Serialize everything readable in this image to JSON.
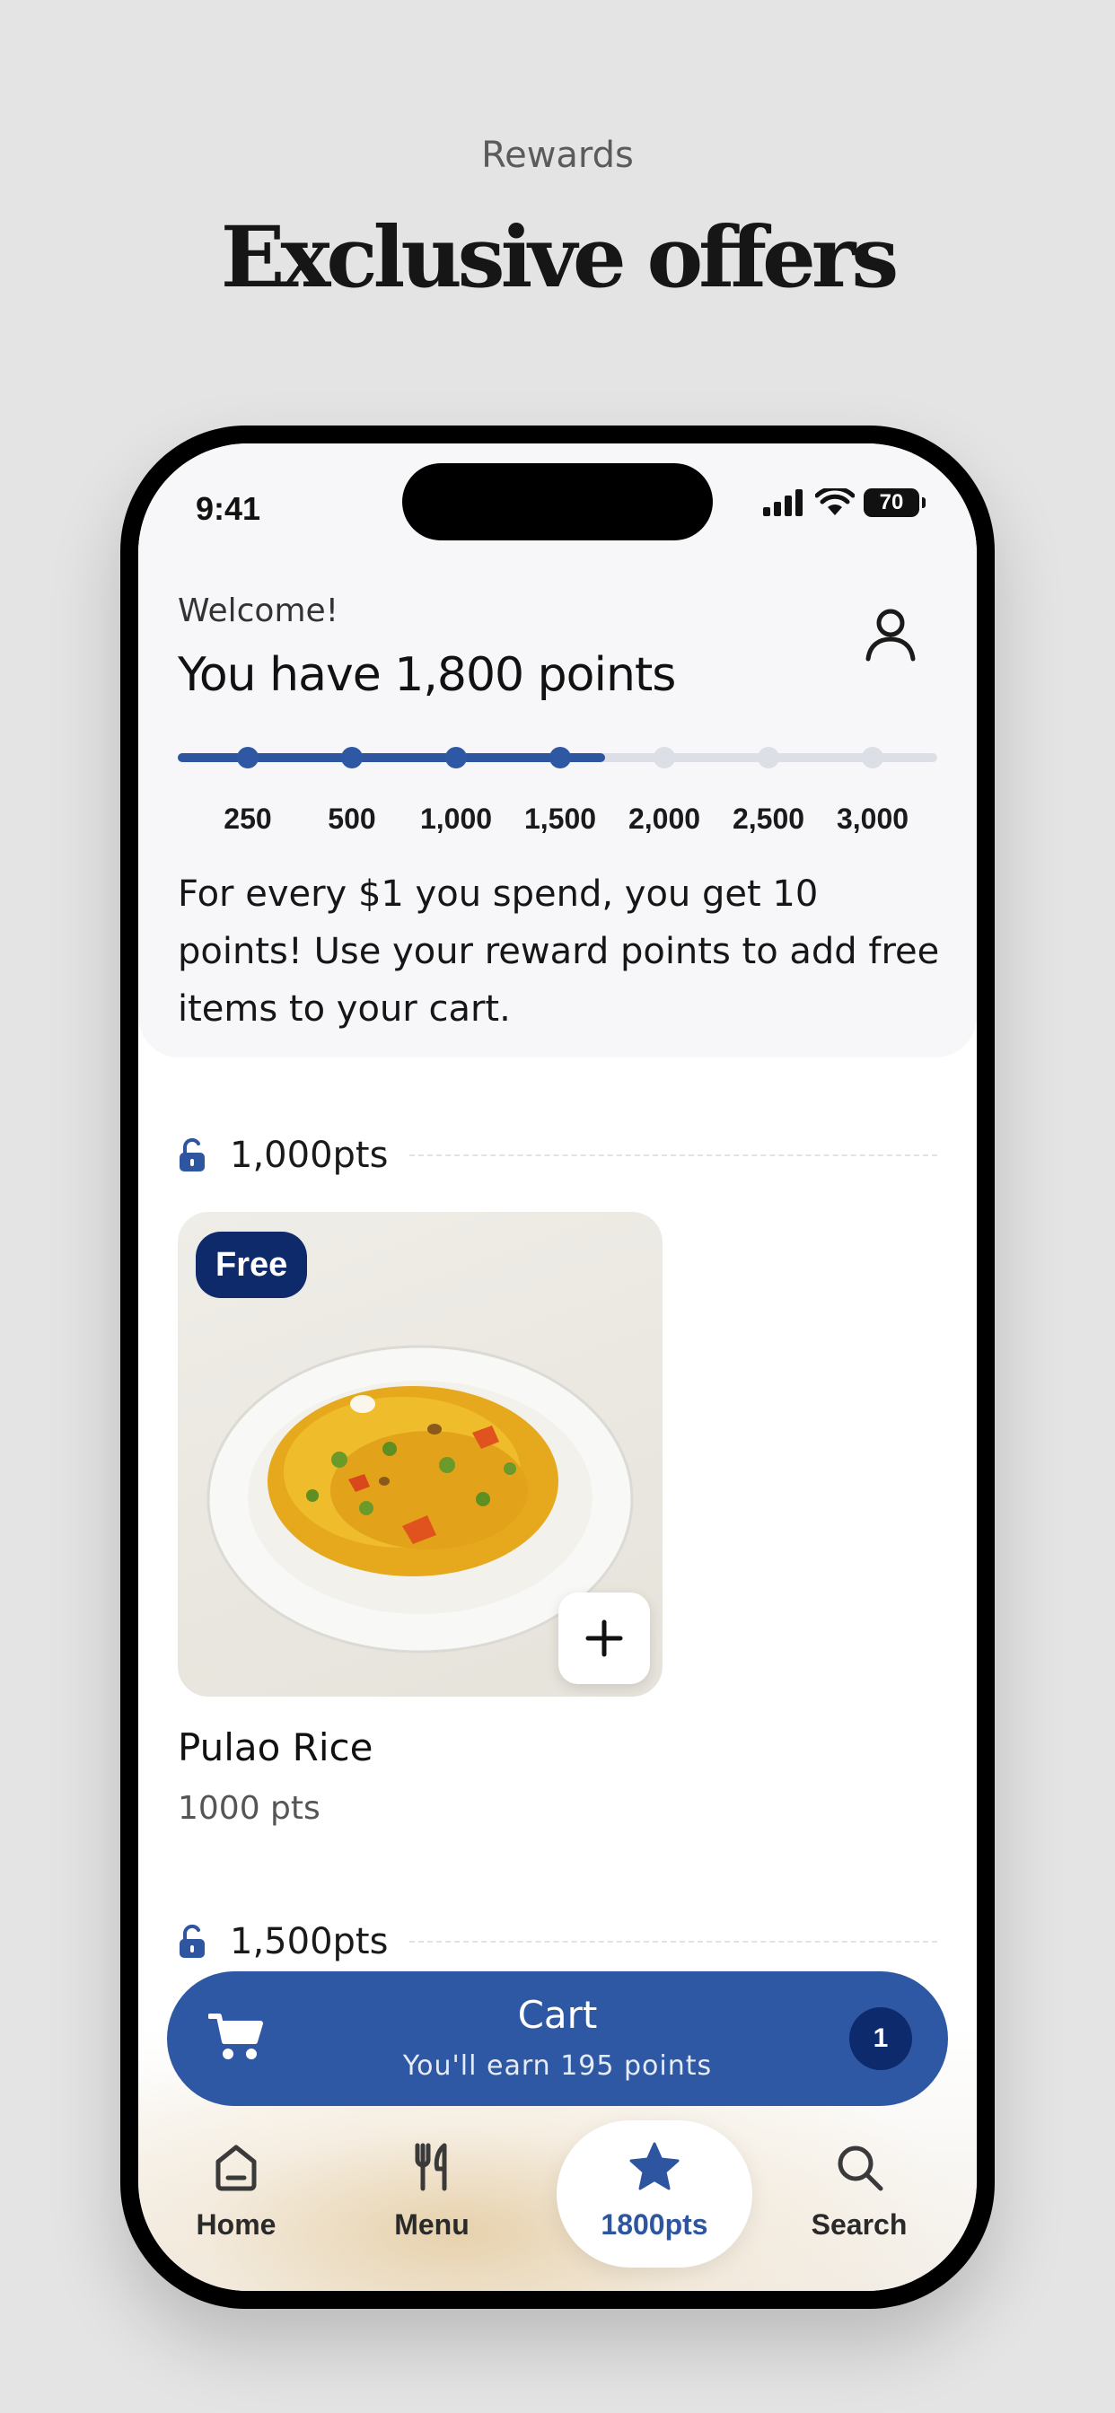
{
  "header": {
    "eyebrow": "Rewards",
    "title": "Exclusive offers"
  },
  "status_bar": {
    "time": "9:41",
    "battery": "70",
    "icons": [
      "signal-icon",
      "wifi-icon",
      "battery-icon"
    ]
  },
  "rewards": {
    "welcome": "Welcome!",
    "points_title": "You have 1,800 points",
    "progress_fraction": 0.563,
    "milestones": [
      "250",
      "500",
      "1,000",
      "1,500",
      "2,000",
      "2,500",
      "3,000"
    ],
    "reached_count": 4,
    "info": "For every $1 you spend, you get 10 points! Use your reward points to add free items to your cart."
  },
  "tiers": [
    {
      "label": "1,000pts",
      "icon": "unlock-icon"
    },
    {
      "label": "1,500pts",
      "icon": "unlock-icon"
    }
  ],
  "item": {
    "badge": "Free",
    "name": "Pulao Rice",
    "points": "1000 pts",
    "add_icon": "plus-icon"
  },
  "cart": {
    "title": "Cart",
    "subtitle": "You'll earn 195 points",
    "count": "1"
  },
  "nav": {
    "items": [
      {
        "label": "Home",
        "icon": "home-icon"
      },
      {
        "label": "Menu",
        "icon": "fork-knife-icon"
      },
      {
        "label": "1800pts",
        "icon": "star-icon",
        "active": true
      },
      {
        "label": "Search",
        "icon": "search-icon"
      }
    ]
  },
  "colors": {
    "accent": "#2f58a4",
    "badge": "#0f2a6b",
    "track": "#dcdfe5",
    "background": "#e4e4e4"
  }
}
